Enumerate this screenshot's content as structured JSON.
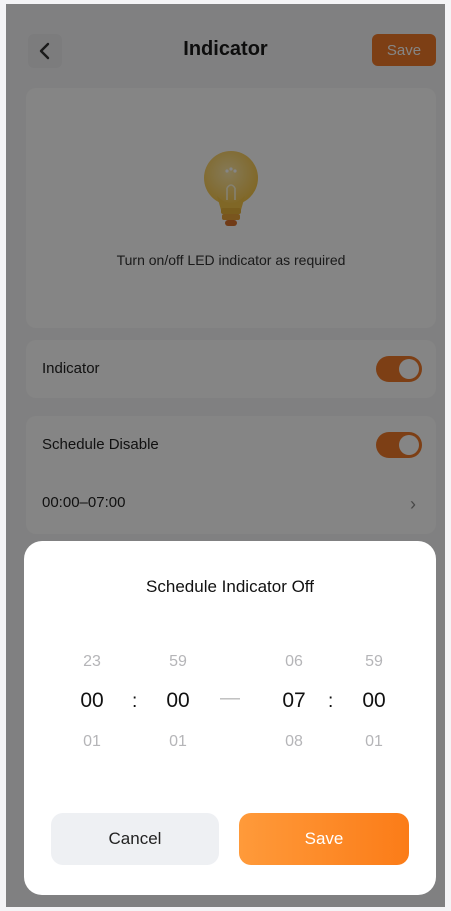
{
  "header": {
    "title": "Indicator",
    "save_label": "Save"
  },
  "hero": {
    "description": "Turn on/off LED indicator as required"
  },
  "settings": {
    "indicator_label": "Indicator",
    "indicator_on": true,
    "schedule_label": "Schedule Disable",
    "schedule_on": true,
    "schedule_range": "00:00–07:00"
  },
  "sheet": {
    "title": "Schedule Indicator Off",
    "start_hour": {
      "prev": "23",
      "current": "00",
      "next": "01"
    },
    "start_minute": {
      "prev": "59",
      "current": "00",
      "next": "01"
    },
    "end_hour": {
      "prev": "06",
      "current": "07",
      "next": "08"
    },
    "end_minute": {
      "prev": "59",
      "current": "00",
      "next": "01"
    },
    "separator": ":",
    "range_dash": "—",
    "cancel_label": "Cancel",
    "save_label": "Save"
  },
  "colors": {
    "accent": "#f07a2a",
    "overlay": "rgba(0,0,0,0.48)"
  }
}
